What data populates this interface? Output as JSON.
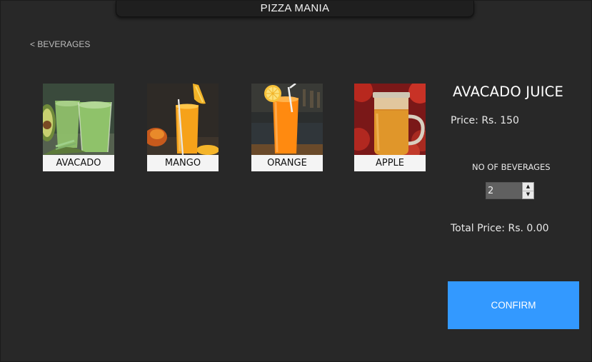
{
  "window": {
    "title": "PIZZA MANIA"
  },
  "nav": {
    "back_label": "< BEVERAGES"
  },
  "beverages": [
    {
      "label": "AVACADO",
      "icon": "avocado-juice-image"
    },
    {
      "label": "MANGO",
      "icon": "mango-juice-image"
    },
    {
      "label": "ORANGE",
      "icon": "orange-juice-image"
    },
    {
      "label": "APPLE",
      "icon": "apple-juice-image"
    }
  ],
  "detail": {
    "title": "AVACADO JUICE",
    "price": "Price: Rs. 150",
    "qty_label": "NO OF BEVERAGES",
    "qty_value": "2",
    "total": "Total Price: Rs.  0.00",
    "confirm_label": "CONFIRM"
  },
  "colors": {
    "background": "#282828",
    "accent": "#3399ff",
    "label_bg": "#f4f4f4"
  }
}
